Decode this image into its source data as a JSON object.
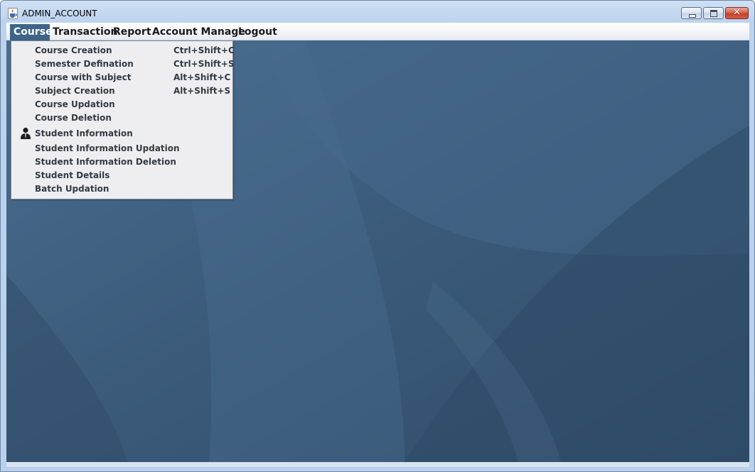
{
  "window": {
    "title": "ADMIN_ACCOUNT",
    "icon": "java-coffee-icon",
    "controls": {
      "minimize": "minimize-icon",
      "maximize": "maximize-icon",
      "close_glyph": "✕"
    }
  },
  "menubar": {
    "items": [
      {
        "label": "Course",
        "active": true
      },
      {
        "label": "Transaction"
      },
      {
        "label": "Report"
      },
      {
        "label": "Account Manage"
      },
      {
        "label": "Logout"
      }
    ]
  },
  "course_menu": {
    "items": [
      {
        "label": "Course Creation",
        "shortcut": "Ctrl+Shift+C"
      },
      {
        "label": "Semester Defination",
        "shortcut": "Ctrl+Shift+S"
      },
      {
        "label": "Course with Subject",
        "shortcut": "Alt+Shift+C"
      },
      {
        "label": "Subject Creation",
        "shortcut": "Alt+Shift+S"
      },
      {
        "label": "Course Updation"
      },
      {
        "label": "Course Deletion"
      },
      {
        "label": "Student Information",
        "icon": "student-icon"
      },
      {
        "label": "Student Information Updation"
      },
      {
        "label": "Student Information Deletion"
      },
      {
        "label": "Student Details"
      },
      {
        "label": "Batch Updation"
      }
    ]
  },
  "colors": {
    "menu_active": "#3e6589",
    "desktop": "#3a5877",
    "dropdown_bg": "#eeeef1"
  }
}
